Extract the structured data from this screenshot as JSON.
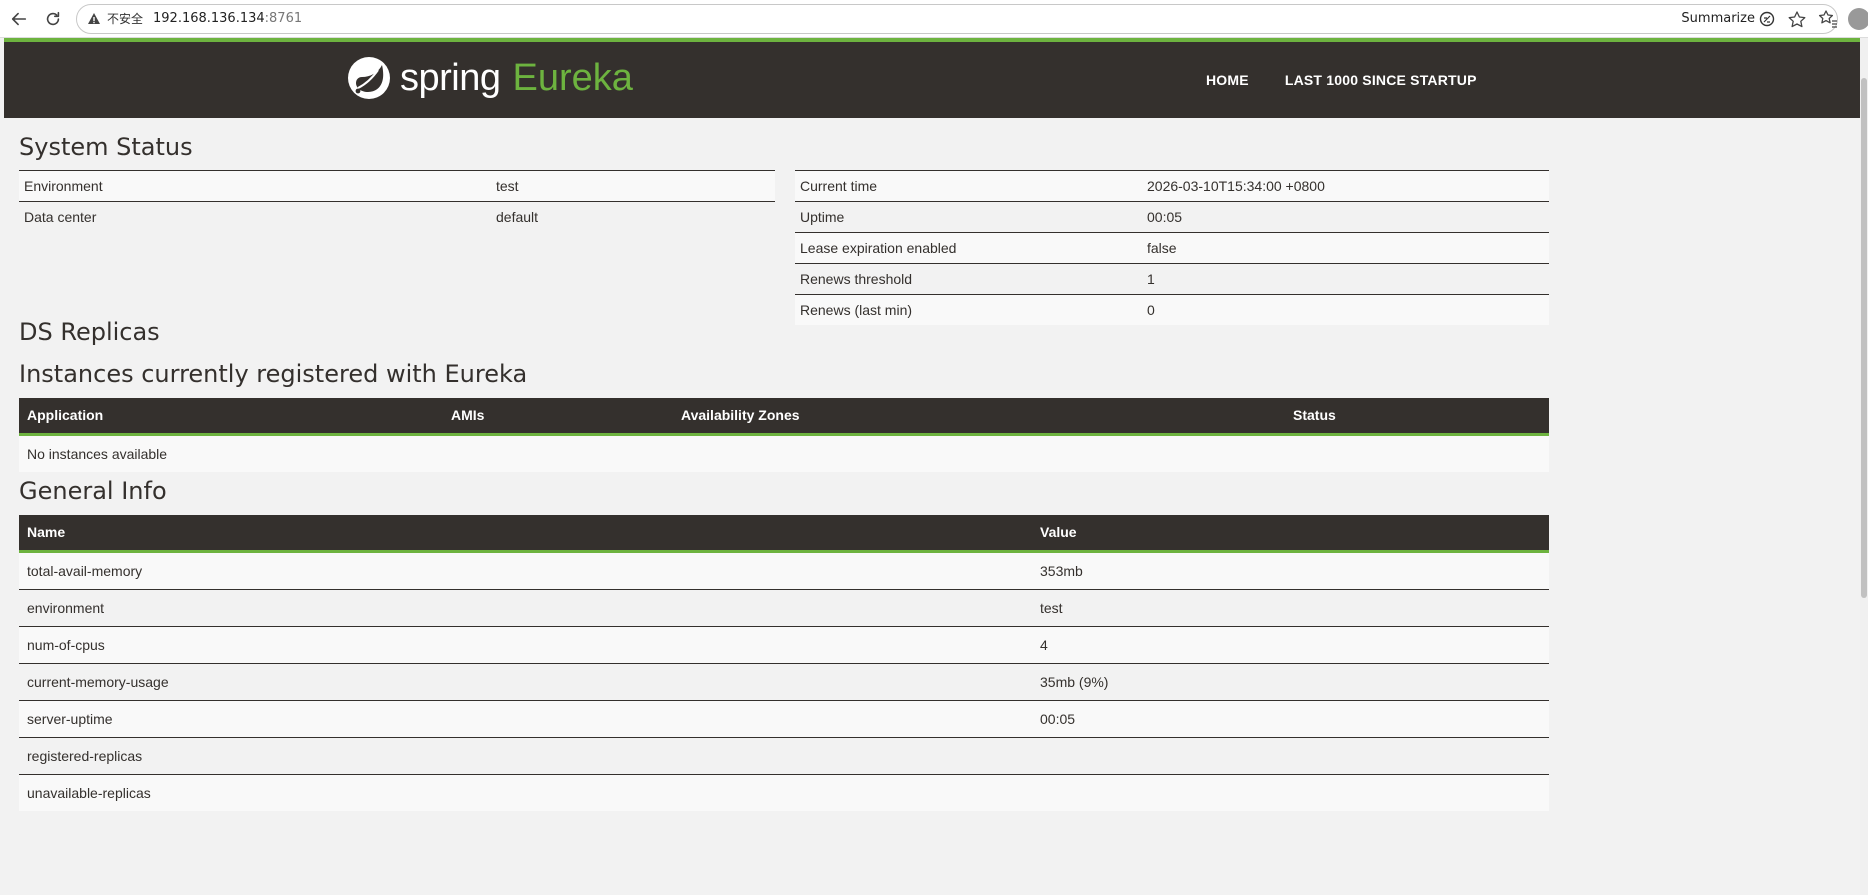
{
  "browser": {
    "insecure_label": "不安全",
    "host": "192.168.136.134",
    "port": ":8761",
    "summarize_label": "Summarize"
  },
  "navbar": {
    "brand_spring": "spring",
    "brand_eureka": "Eureka",
    "links": [
      "HOME",
      "LAST 1000 SINCE STARTUP"
    ]
  },
  "system_status": {
    "heading": "System Status",
    "left": [
      {
        "key": "Environment",
        "value": "test"
      },
      {
        "key": "Data center",
        "value": "default"
      }
    ],
    "right": [
      {
        "key": "Current time",
        "value": "2026-03-10T15:34:00 +0800"
      },
      {
        "key": "Uptime",
        "value": "00:05"
      },
      {
        "key": "Lease expiration enabled",
        "value": "false"
      },
      {
        "key": "Renews threshold",
        "value": "1"
      },
      {
        "key": "Renews (last min)",
        "value": "0"
      }
    ]
  },
  "ds_replicas": {
    "heading": "DS Replicas"
  },
  "instances": {
    "heading": "Instances currently registered with Eureka",
    "columns": [
      "Application",
      "AMIs",
      "Availability Zones",
      "Status"
    ],
    "empty_text": "No instances available"
  },
  "general_info": {
    "heading": "General Info",
    "columns": [
      "Name",
      "Value"
    ],
    "rows": [
      {
        "name": "total-avail-memory",
        "value": "353mb"
      },
      {
        "name": "environment",
        "value": "test"
      },
      {
        "name": "num-of-cpus",
        "value": "4"
      },
      {
        "name": "current-memory-usage",
        "value": "35mb (9%)"
      },
      {
        "name": "server-uptime",
        "value": "00:05"
      },
      {
        "name": "registered-replicas",
        "value": ""
      },
      {
        "name": "unavailable-replicas",
        "value": ""
      }
    ]
  },
  "colors": {
    "brand_green": "#6db33f",
    "header_dark": "#34302d",
    "page_bg": "#f2f2f2"
  }
}
